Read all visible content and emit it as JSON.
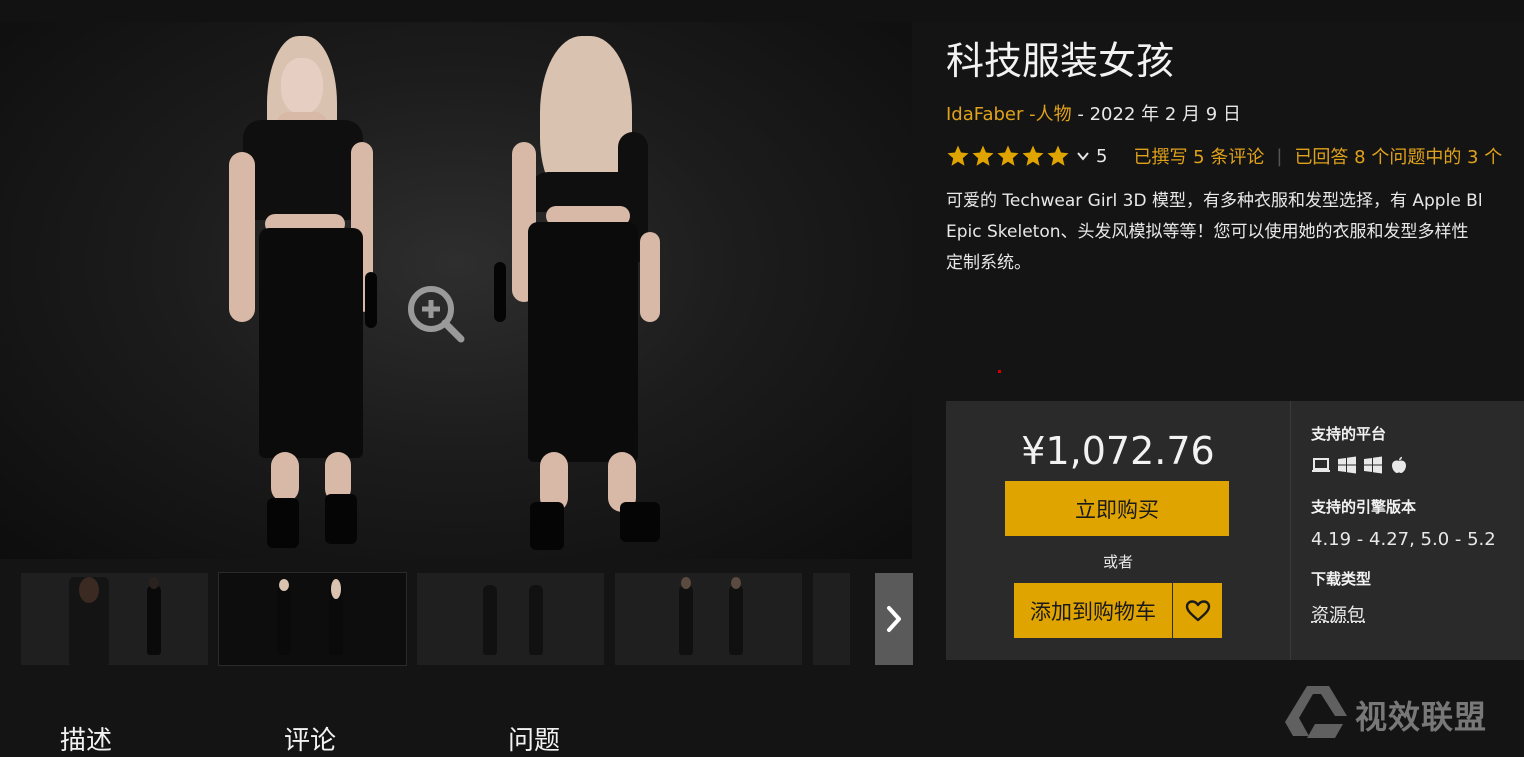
{
  "product": {
    "title": "科技服装女孩",
    "author": "IdaFaber",
    "category": "-人物",
    "date": "- 2022 年 2 月 9 日",
    "rating": "5",
    "reviews_link": "已撰写 5 条评论",
    "questions_link": "已回答 8 个问题中的 3 个",
    "description_lines": [
      "可爱的 Techwear Girl 3D 模型，有多种衣服和发型选择，有 Apple Bl",
      "Epic Skeleton、头发风模拟等等！您可以使用她的衣服和发型多样性",
      "定制系统。"
    ]
  },
  "purchase": {
    "price": "¥1,072.76",
    "buy_label": "立即购买",
    "or_label": "或者",
    "cart_label": "添加到购物车"
  },
  "specs": {
    "platforms_heading": "支持的平台",
    "platform_icons": [
      "laptop-icon",
      "windows-icon",
      "windows-icon",
      "apple-icon"
    ],
    "engine_heading": "支持的引擎版本",
    "engine_versions": "4.19 - 4.27, 5.0 - 5.2",
    "download_heading": "下载类型",
    "download_type": "资源包"
  },
  "tabs": [
    {
      "label": "描述"
    },
    {
      "label": "评论"
    },
    {
      "label": "问题"
    }
  ],
  "watermark": {
    "text": "视效联盟"
  },
  "colors": {
    "accent": "#e0a21a",
    "button": "#e0a400",
    "box": "#2a2a2a",
    "background": "#141414"
  }
}
